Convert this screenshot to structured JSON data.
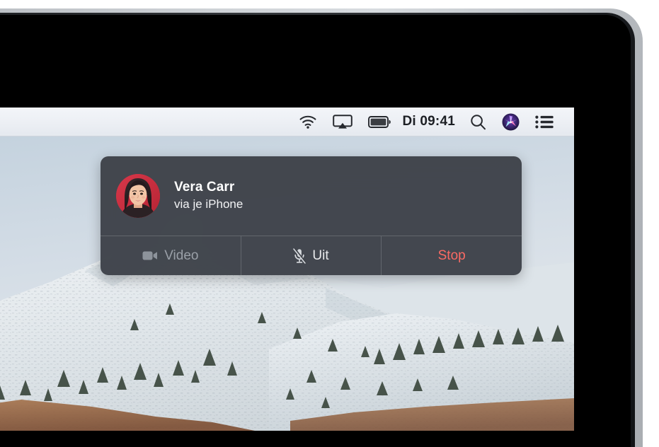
{
  "device": {
    "kind": "macbook-screen-corner",
    "bezel_color": "#000000",
    "lid_color": "#c6cacf"
  },
  "menubar": {
    "clock": "Di 09:41",
    "background": "#eceff4",
    "items": [
      {
        "icon": "wifi-icon",
        "label": "Wi‑Fi"
      },
      {
        "icon": "airplay-icon",
        "label": "AirPlay"
      },
      {
        "icon": "battery-icon",
        "label": "Batterij"
      },
      {
        "icon": "clock-text",
        "label": "Di 09:41"
      },
      {
        "icon": "search-icon",
        "label": "Spotlight"
      },
      {
        "icon": "siri-icon",
        "label": "Siri"
      },
      {
        "icon": "notification-center-icon",
        "label": "Berichtencentrum"
      }
    ]
  },
  "wallpaper": {
    "description": "Besneeuwde bergtop",
    "sky_color": "#d5dde6",
    "snow_color": "#e7ebef",
    "tree_color": "#4a5548",
    "brush_color": "#9b6a4f"
  },
  "notification": {
    "title": "Vera Carr",
    "subtitle": "via je iPhone",
    "avatar": {
      "name": "vera-carr-avatar",
      "background": "#cf3040",
      "hair_color": "#2b2024",
      "skin_color": "#f0c4a8"
    },
    "background": "#3e4249",
    "actions": [
      {
        "id": "video",
        "label": "Video",
        "icon": "video-camera-icon",
        "state": "disabled",
        "color": "#9aa0a8"
      },
      {
        "id": "mute",
        "label": "Uit",
        "icon": "microphone-muted-icon",
        "state": "enabled",
        "color": "#e9eaec"
      },
      {
        "id": "stop",
        "label": "Stop",
        "icon": "none",
        "state": "destructive",
        "color": "#fa6a64"
      }
    ]
  }
}
